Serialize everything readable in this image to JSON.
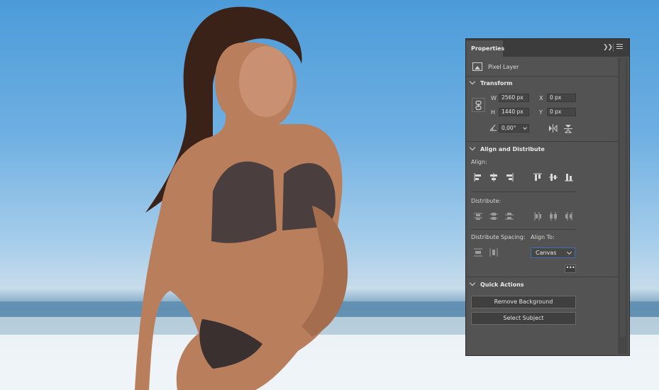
{
  "panel": {
    "tab_label": "Properties",
    "layer_type": "Pixel Layer",
    "transform": {
      "heading": "Transform",
      "w_label": "W",
      "w_value": "2560 px",
      "h_label": "H",
      "h_value": "1440 px",
      "x_label": "X",
      "x_value": "0 px",
      "y_label": "Y",
      "y_value": "0 px",
      "angle_value": "0,00°"
    },
    "align_distribute": {
      "heading": "Align and Distribute",
      "align_label": "Align:",
      "distribute_label": "Distribute:",
      "distribute_spacing_label": "Distribute Spacing:",
      "align_to_label": "Align To:",
      "align_to_value": "Canvas",
      "more_label": "•••"
    },
    "quick_actions": {
      "heading": "Quick Actions",
      "remove_background": "Remove Background",
      "select_subject": "Select Subject"
    }
  },
  "colors": {
    "panel_bg": "#535353",
    "titlebar_bg": "#3c3c3c",
    "focus_accent": "#3d6fb0"
  }
}
